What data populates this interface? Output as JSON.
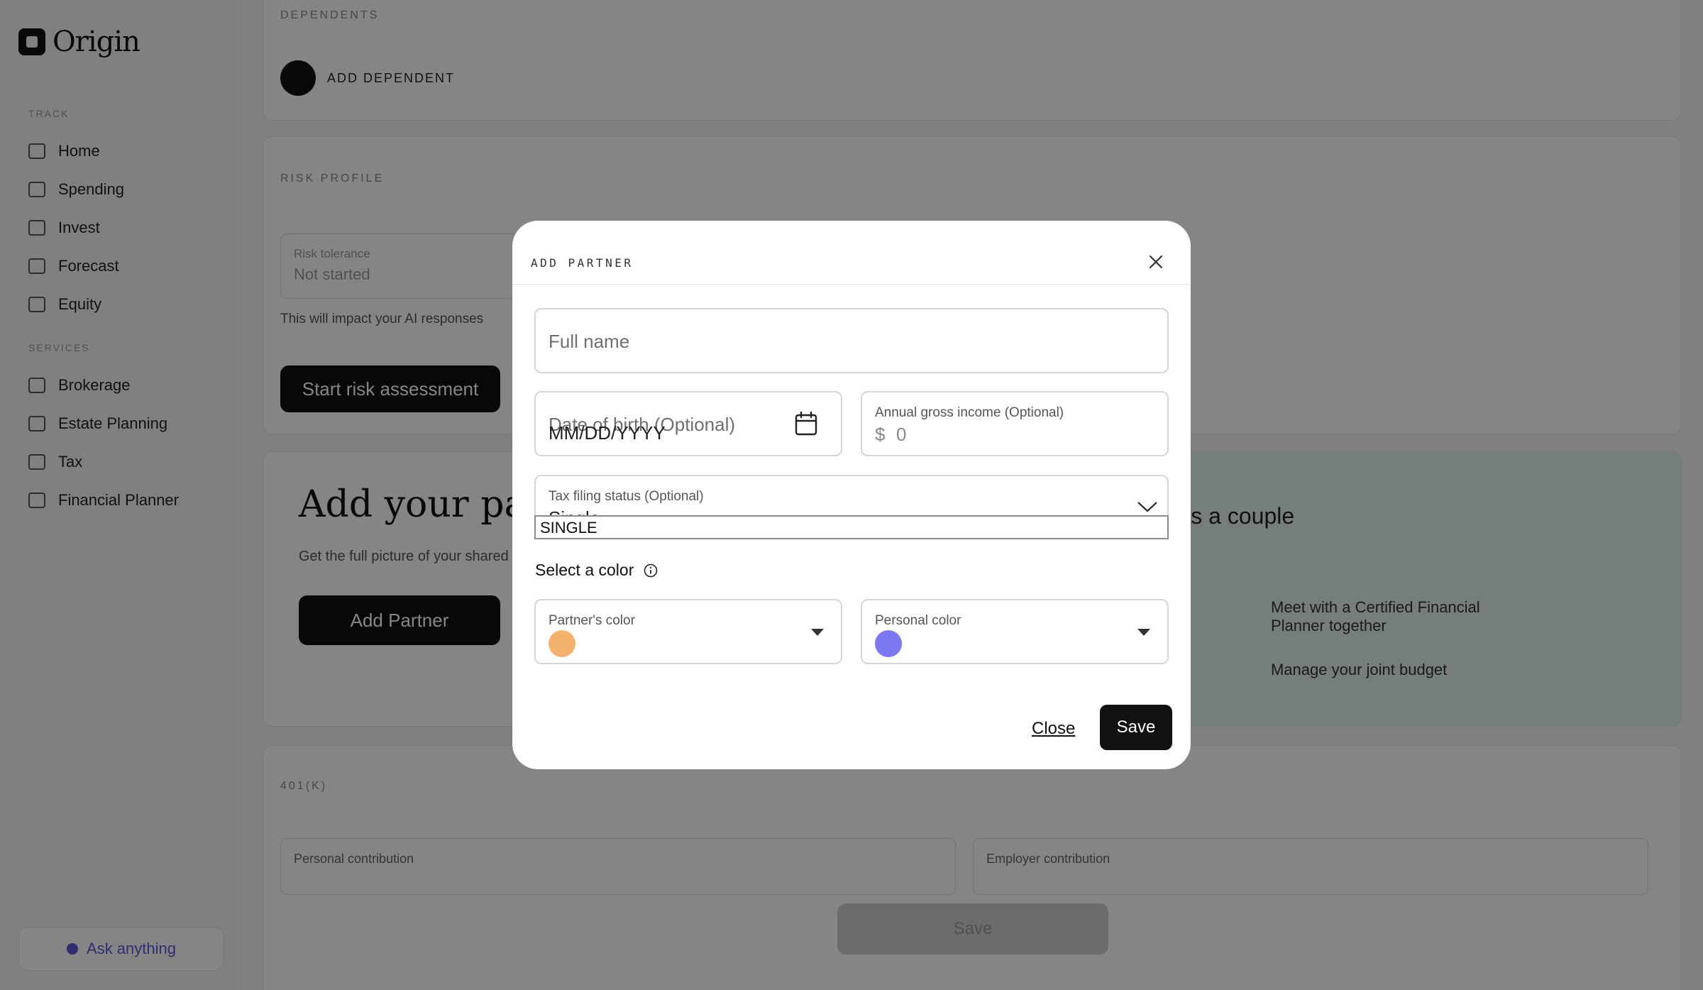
{
  "app": {
    "brand": "Origin"
  },
  "sidebar": {
    "section_track": "TRACK",
    "section_services": "SERVICES",
    "items_track": [
      {
        "label": "Home",
        "icon": "home-icon"
      },
      {
        "label": "Spending",
        "icon": "wallet-icon"
      },
      {
        "label": "Invest",
        "icon": "chart-icon"
      },
      {
        "label": "Forecast",
        "icon": "forecast-icon"
      },
      {
        "label": "Equity",
        "icon": "equity-icon"
      }
    ],
    "items_services": [
      {
        "label": "Brokerage",
        "icon": "trend-icon"
      },
      {
        "label": "Estate Planning",
        "icon": "estate-icon"
      },
      {
        "label": "Tax",
        "icon": "tax-icon"
      },
      {
        "label": "Financial Planner",
        "icon": "planner-icon"
      }
    ],
    "ask_label": "Ask anything"
  },
  "background": {
    "dependents_label": "DEPENDENTS",
    "add_dependent": "ADD DEPENDENT",
    "risk_label": "RISK PROFILE",
    "risk_field_label": "Risk tolerance",
    "risk_field_value": "Not started",
    "risk_note": "This will impact your AI responses",
    "risk_button": "Start risk assessment",
    "partner_heading": "Add your partner",
    "partner_sub": "Get the full picture of your shared finances",
    "partner_button": "Add Partner",
    "couple_heading": "Manage money as a couple",
    "bullet_1": "Meet with a Certified Financial Planner together",
    "bullet_2": "Manage your joint budget",
    "k401_label": "401(K)",
    "personal_contribution": "Personal contribution",
    "employer_contribution": "Employer contribution",
    "save_disabled": "Save"
  },
  "modal": {
    "title": "ADD PARTNER",
    "full_name_placeholder": "Full name",
    "dob_placeholder": "Date of birth (Optional)",
    "dob_format": "MM/DD/YYYY",
    "income_label": "Annual gross income (Optional)",
    "income_currency": "$",
    "income_value": "0",
    "tax_label": "Tax filing status (Optional)",
    "tax_value": "Single",
    "tax_select_value": "SINGLE",
    "color_heading": "Select a color",
    "partner_color_label": "Partner's color",
    "partner_color": "#f2b26b",
    "personal_color_label": "Personal color",
    "personal_color": "#7b78f2",
    "close_label": "Close",
    "save_label": "Save"
  }
}
